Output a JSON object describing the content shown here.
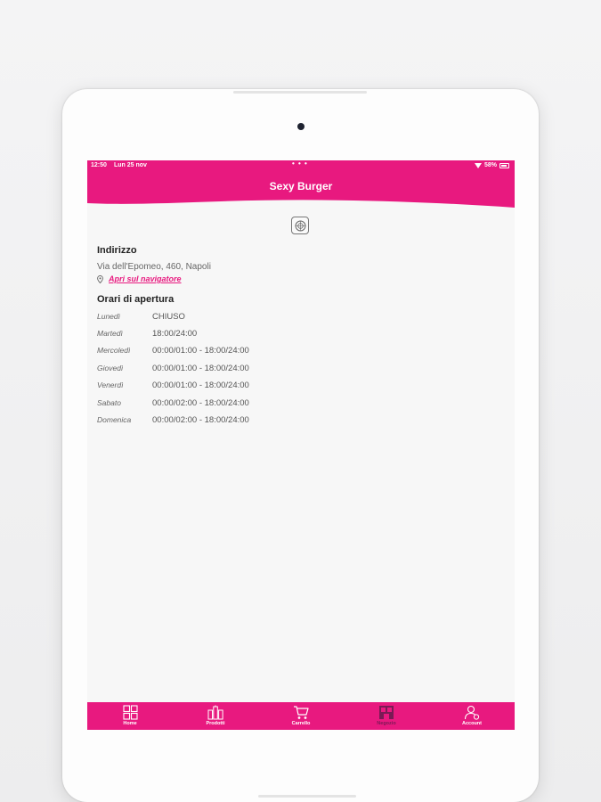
{
  "status_bar": {
    "time": "12:50",
    "date": "Lun 25 nov",
    "dots": "• • •",
    "battery": "58%"
  },
  "header": {
    "title": "Sexy Burger"
  },
  "address_section": {
    "title": "Indirizzo",
    "address": "Via dell'Epomeo, 460, Napoli",
    "navigator_link": "Apri sul navigatore"
  },
  "hours_section": {
    "title": "Orari di apertura",
    "rows": [
      {
        "day": "Lunedì",
        "time": "CHIUSO"
      },
      {
        "day": "Martedì",
        "time": "18:00/24:00"
      },
      {
        "day": "Mercoledì",
        "time": "00:00/01:00 - 18:00/24:00"
      },
      {
        "day": "Giovedì",
        "time": "00:00/01:00 - 18:00/24:00"
      },
      {
        "day": "Venerdì",
        "time": "00:00/01:00 - 18:00/24:00"
      },
      {
        "day": "Sabato",
        "time": "00:00/02:00 - 18:00/24:00"
      },
      {
        "day": "Domenica",
        "time": "00:00/02:00 - 18:00/24:00"
      }
    ]
  },
  "tabbar": {
    "items": [
      {
        "label": "Home",
        "icon": "home-grid-icon"
      },
      {
        "label": "Prodotti",
        "icon": "products-icon"
      },
      {
        "label": "Carrello",
        "icon": "cart-icon"
      },
      {
        "label": "Negozio",
        "icon": "store-icon",
        "active": true
      },
      {
        "label": "Account",
        "icon": "account-icon"
      }
    ]
  },
  "colors": {
    "brand": "#e8197f",
    "active_tab_label": "#7a1a55",
    "background": "#f7f7f7"
  }
}
